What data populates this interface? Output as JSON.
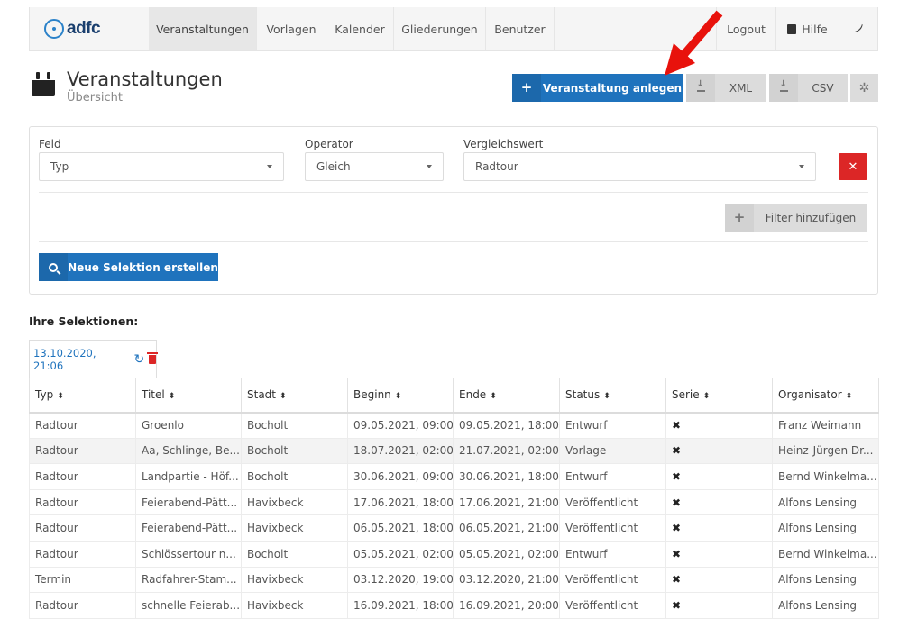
{
  "brand": {
    "logo_text": "adfc"
  },
  "nav": {
    "items": [
      "Veranstaltungen",
      "Vorlagen",
      "Kalender",
      "Gliederungen",
      "Benutzer"
    ],
    "logout": "Logout",
    "help": "Hilfe"
  },
  "header": {
    "title": "Veranstaltungen",
    "subtitle": "Übersicht"
  },
  "actions": {
    "create": "Veranstaltung anlegen",
    "xml": "XML",
    "csv": "CSV"
  },
  "filter": {
    "field_label": "Feld",
    "operator_label": "Operator",
    "value_label": "Vergleichswert",
    "field_value": "Typ",
    "operator_value": "Gleich",
    "compare_value": "Radtour",
    "add_filter": "Filter hinzufügen",
    "new_selection": "Neue Selektion erstellen"
  },
  "selections": {
    "title": "Ihre Selektionen:",
    "tab_label": "13.10.2020, 21:06"
  },
  "table": {
    "headers": [
      "Typ",
      "Titel",
      "Stadt",
      "Beginn",
      "Ende",
      "Status",
      "Serie",
      "Organisator"
    ],
    "rows": [
      [
        "Radtour",
        "Groenlo",
        "Bocholt",
        "09.05.2021, 09:00",
        "09.05.2021, 18:00",
        "Entwurf",
        "✖",
        "Franz Weimann"
      ],
      [
        "Radtour",
        "Aa, Schlinge, Be...",
        "Bocholt",
        "18.07.2021, 02:00",
        "21.07.2021, 02:00",
        "Vorlage",
        "✖",
        "Heinz-Jürgen Dr..."
      ],
      [
        "Radtour",
        "Landpartie - Höf...",
        "Bocholt",
        "30.06.2021, 09:00",
        "30.06.2021, 18:00",
        "Entwurf",
        "✖",
        "Bernd Winkelma..."
      ],
      [
        "Radtour",
        "Feierabend-Pätt...",
        "Havixbeck",
        "17.06.2021, 18:00",
        "17.06.2021, 21:00",
        "Veröffentlicht",
        "✖",
        "Alfons Lensing"
      ],
      [
        "Radtour",
        "Feierabend-Pätt...",
        "Havixbeck",
        "06.05.2021, 18:00",
        "06.05.2021, 21:00",
        "Veröffentlicht",
        "✖",
        "Alfons Lensing"
      ],
      [
        "Radtour",
        "Schlössertour n...",
        "Bocholt",
        "05.05.2021, 02:00",
        "05.05.2021, 02:00",
        "Entwurf",
        "✖",
        "Bernd Winkelma..."
      ],
      [
        "Termin",
        "Radfahrer-Stam...",
        "Havixbeck",
        "03.12.2020, 19:00",
        "03.12.2020, 21:00",
        "Veröffentlicht",
        "✖",
        "Alfons Lensing"
      ],
      [
        "Radtour",
        "schnelle Feierab...",
        "Havixbeck",
        "16.09.2021, 18:00",
        "16.09.2021, 20:00",
        "Veröffentlicht",
        "✖",
        "Alfons Lensing"
      ]
    ]
  },
  "colors": {
    "primary": "#1f73bd",
    "danger": "#dc2626",
    "arrow": "#e8120c"
  }
}
